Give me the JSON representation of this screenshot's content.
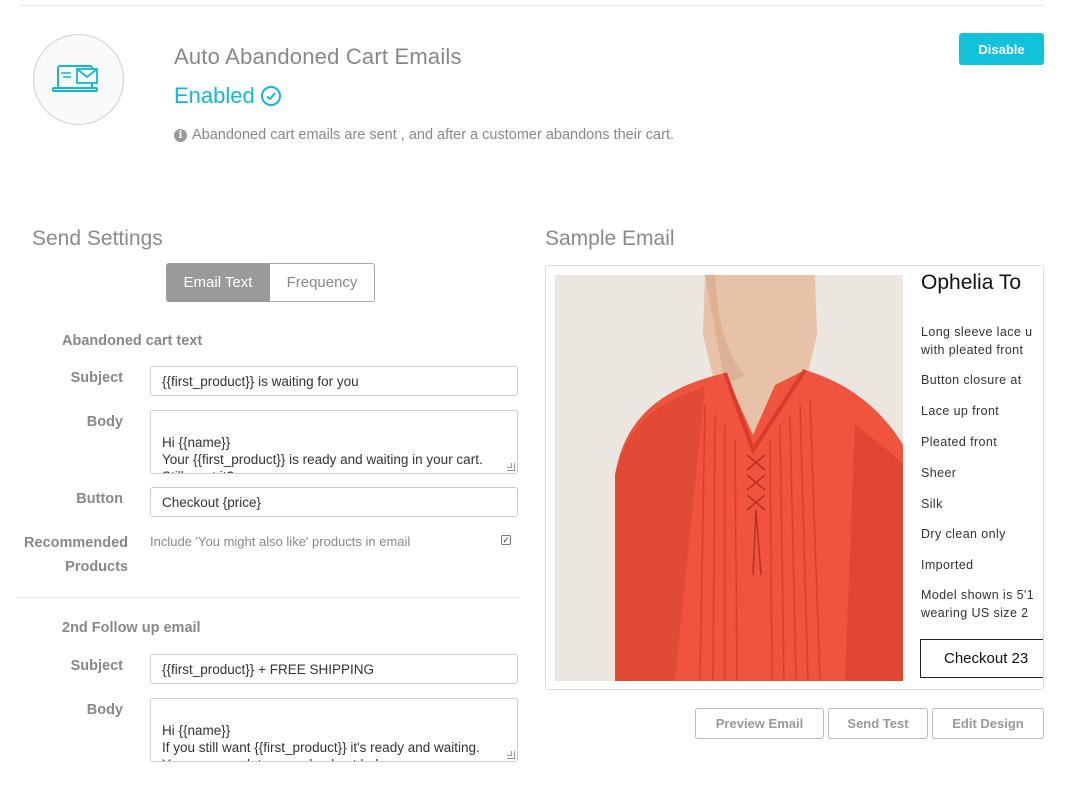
{
  "header": {
    "title": "Auto Abandoned Cart Emails",
    "status": "Enabled",
    "description": "Abandoned cart emails are sent , and after a customer abandons their cart.",
    "disable_button": "Disable",
    "accent_color": "#12b9d0"
  },
  "send_settings": {
    "title": "Send Settings",
    "tabs": [
      {
        "label": "Email Text",
        "active": true
      },
      {
        "label": "Frequency",
        "active": false
      }
    ],
    "abandoned_cart": {
      "heading": "Abandoned cart text",
      "subject_label": "Subject",
      "subject_value": "{{first_product}} is waiting for you",
      "body_label": "Body",
      "body_value": "Hi {{name}}\nYour {{first_product}} is ready and waiting in your cart. Still want it?",
      "button_label": "Button",
      "button_value": "Checkout {price}",
      "recommended_label_1": "Recommended",
      "recommended_label_2": "Products",
      "recommended_text": "Include 'You might also like' products in email",
      "recommended_checked": true
    },
    "follow_up": {
      "heading": "2nd Follow up email",
      "subject_label": "Subject",
      "subject_value": "{{first_product}} + FREE SHIPPING",
      "body_label": "Body",
      "body_value": "Hi {{name}}\nIf you still want {{first_product}} it's ready and waiting. You can complete your checkout below."
    }
  },
  "sample_email": {
    "title": "Sample Email",
    "product_title": "Ophelia To",
    "details": [
      "Long sleeve lace u",
      "with pleated front",
      "Button closure at",
      "Lace up front",
      "Pleated front",
      "Sheer",
      "Silk",
      "Dry clean only",
      "Imported",
      "Model shown is 5'1",
      "wearing US size 2"
    ],
    "checkout_button": "Checkout 23",
    "buttons": {
      "preview": "Preview Email",
      "send_test": "Send Test",
      "edit_design": "Edit Design"
    }
  },
  "icons": {
    "hero": "laptop-email-icon",
    "status": "check-circle-icon",
    "info": "info-icon"
  }
}
